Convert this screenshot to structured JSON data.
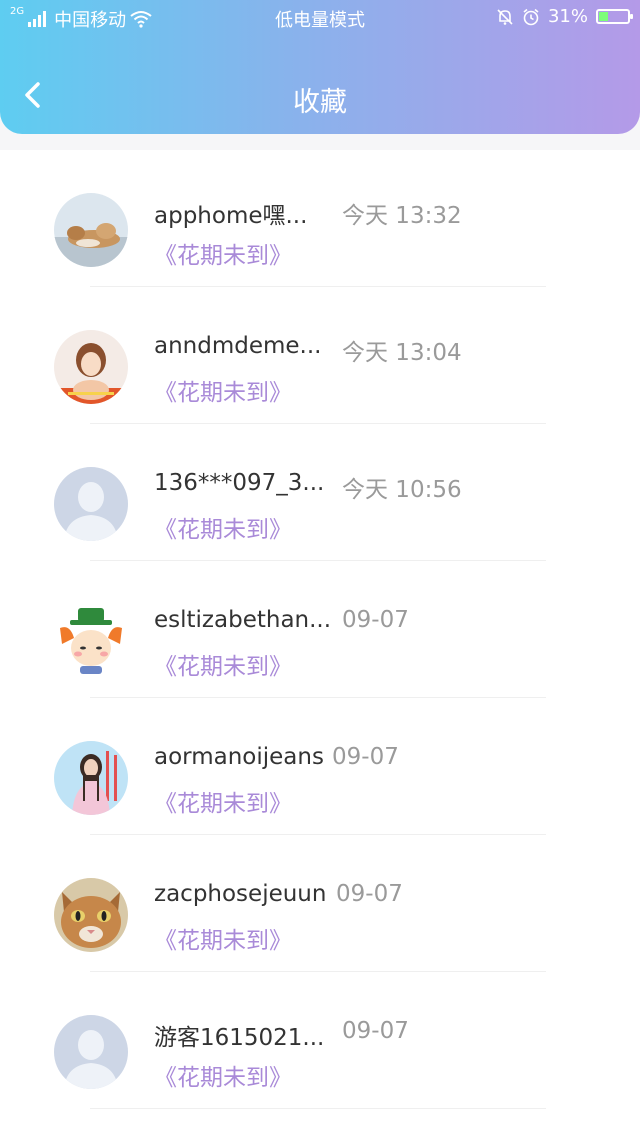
{
  "status_bar": {
    "network": "2G",
    "carrier": "中国移动",
    "mode": "低电量模式",
    "battery": "31%",
    "battery_level": 0.31
  },
  "header": {
    "title": "收藏",
    "back_icon": "chevron-left-icon"
  },
  "items": [
    {
      "username": "apphome嘿...",
      "time": "今天 13:32",
      "book": "《花期未到》",
      "avatar": "cat-photo"
    },
    {
      "username": "anndmdeme...",
      "time": "今天 13:04",
      "book": "《花期未到》",
      "avatar": "girl-photo"
    },
    {
      "username": "136***097_3...",
      "time": "今天 10:56",
      "book": "《花期未到》",
      "avatar": "default-avatar"
    },
    {
      "username": "esltizabethan...",
      "time": "09-07",
      "book": "《花期未到》",
      "avatar": "cartoon-clown"
    },
    {
      "username": "aormanoijeans",
      "time": "09-07",
      "book": "《花期未到》",
      "avatar": "woman-photo"
    },
    {
      "username": "zacphosejeuun",
      "time": "09-07",
      "book": "《花期未到》",
      "avatar": "kitten-photo"
    },
    {
      "username": "游客1615021...",
      "time": "09-07",
      "book": "《花期未到》",
      "avatar": "default-avatar"
    }
  ],
  "colors": {
    "accent": "#a98ad8",
    "header_start": "#5ecdf1",
    "header_end": "#b49ae8"
  }
}
